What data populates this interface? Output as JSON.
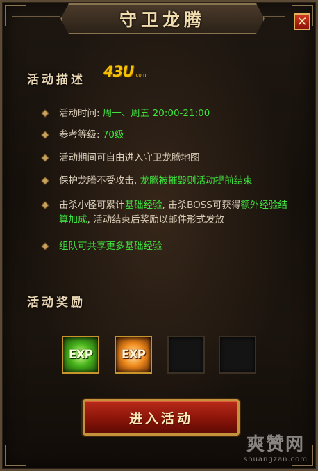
{
  "panel": {
    "title": "守卫龙腾",
    "close_label": "✕"
  },
  "description": {
    "section_title": "活动描述",
    "logo_main": "43U",
    "logo_sub": ".com",
    "items": [
      {
        "parts": [
          {
            "text": "活动时间: ",
            "color": "normal"
          },
          {
            "text": "周一、周五 20:00-21:00",
            "color": "green"
          }
        ]
      },
      {
        "parts": [
          {
            "text": "参考等级: ",
            "color": "normal"
          },
          {
            "text": "70级",
            "color": "green"
          }
        ]
      },
      {
        "parts": [
          {
            "text": "活动期间可自由进入守卫龙腾地图",
            "color": "normal"
          }
        ]
      },
      {
        "parts": [
          {
            "text": "保护龙腾不受攻击, ",
            "color": "normal"
          },
          {
            "text": "龙腾被摧毁则活动提前结束",
            "color": "green"
          }
        ]
      },
      {
        "parts": [
          {
            "text": "击杀小怪可累计",
            "color": "normal"
          },
          {
            "text": "基础经验",
            "color": "green"
          },
          {
            "text": ", 击杀BOSS可获得",
            "color": "normal"
          },
          {
            "text": "额外经验结算加成",
            "color": "green"
          },
          {
            "text": ", 活动结束后奖励以邮件形式发放",
            "color": "normal"
          }
        ]
      },
      {
        "parts": [
          {
            "text": "组队可共享更多基础经验",
            "color": "green"
          }
        ]
      }
    ]
  },
  "rewards": {
    "section_title": "活动奖励",
    "slots": [
      {
        "label": "EXP",
        "style": "green",
        "icon": "exp-green-icon"
      },
      {
        "label": "EXP",
        "style": "orange",
        "icon": "exp-orange-icon"
      },
      {
        "label": "",
        "style": "empty"
      },
      {
        "label": "",
        "style": "empty"
      }
    ]
  },
  "enter_button": {
    "label": "进入活动"
  },
  "watermark": {
    "main": "爽赞网",
    "sub": "shuangzan.com"
  },
  "colors": {
    "green_text": "#3fe03f",
    "body_text": "#d9cdb9",
    "button_red": "#8a1409",
    "gold_border": "#c4923b"
  }
}
